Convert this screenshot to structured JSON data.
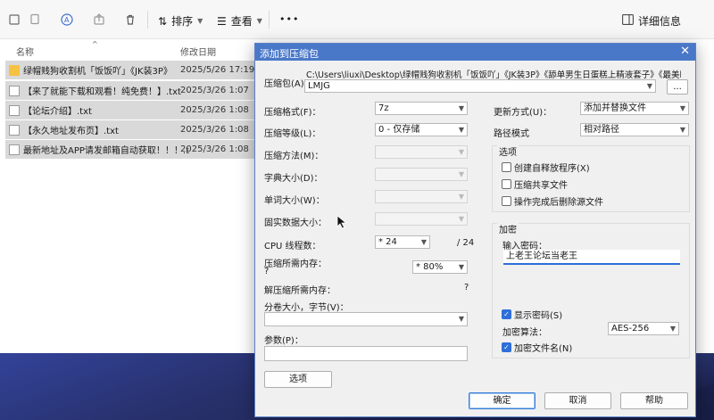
{
  "explorer": {
    "toolbar": {
      "sort_label": "排序",
      "view_label": "查看",
      "more_label": "•••",
      "details_label": "详细信息"
    },
    "columns": {
      "name": "名称",
      "modified": "修改日期"
    },
    "files": [
      {
        "name": "绿帽贱狗收割机「饭饭吖」《JK装3P》",
        "date": "2025/5/26 17:19",
        "type": "folder"
      },
      {
        "name": "【来了就能下载和观看！纯免费！】.txt",
        "date": "2025/3/26 1:07",
        "type": "txt"
      },
      {
        "name": "【论坛介绍】.txt",
        "date": "2025/3/26 1:08",
        "type": "txt"
      },
      {
        "name": "【永久地址发布页】.txt",
        "date": "2025/3/26 1:08",
        "type": "txt"
      },
      {
        "name": "最新地址及APP请发邮箱自动获取！！！.txt",
        "date": "2025/3/26 1:08",
        "type": "txt"
      }
    ]
  },
  "dialog": {
    "title": "添加到压缩包",
    "close_symbol": "✕",
    "archive_label": "压缩包(A)：",
    "archive_path": "C:\\Users\\liuxi\\Desktop\\绿帽贱狗收割机「饭饭吖」《JK装3P》《舔单男生日蛋糕上精液套子》《最美瞬间》\\",
    "archive_name": "LMJG",
    "browse_label": "...",
    "format_label": "压缩格式(F)：",
    "format_value": "7z",
    "level_label": "压缩等级(L)：",
    "level_value": "0 - 仅存储",
    "method_label": "压缩方法(M)：",
    "dict_label": "字典大小(D)：",
    "word_label": "单词大小(W)：",
    "solid_label": "固实数据大小：",
    "threads_label": "CPU 线程数：",
    "threads_value": "* 24",
    "threads_max": "/ 24",
    "mem_compress_label": "压缩所需内存：",
    "mem_compress_q": "?",
    "mem_compress_value": "* 80%",
    "mem_decompress_label": "解压缩所需内存：",
    "mem_decompress_value": "?",
    "split_label": "分卷大小，字节(V)：",
    "params_label": "参数(P)：",
    "options_button": "选项",
    "update_label": "更新方式(U)：",
    "update_value": "添加并替换文件",
    "path_label": "路径模式",
    "path_value": "相对路径",
    "options_group": "选项",
    "opt_sfx": "创建自释放程序(X)",
    "opt_shared": "压缩共享文件",
    "opt_delete": "操作完成后删除源文件",
    "encrypt_group": "加密",
    "password_label": "输入密码：",
    "password_value": "上老王论坛当老王",
    "show_password": "显示密码(S)",
    "encrypt_method_label": "加密算法：",
    "encrypt_method_value": "AES-256",
    "encrypt_names": "加密文件名(N)",
    "ok_button": "确定",
    "cancel_button": "取消",
    "help_button": "帮助"
  }
}
